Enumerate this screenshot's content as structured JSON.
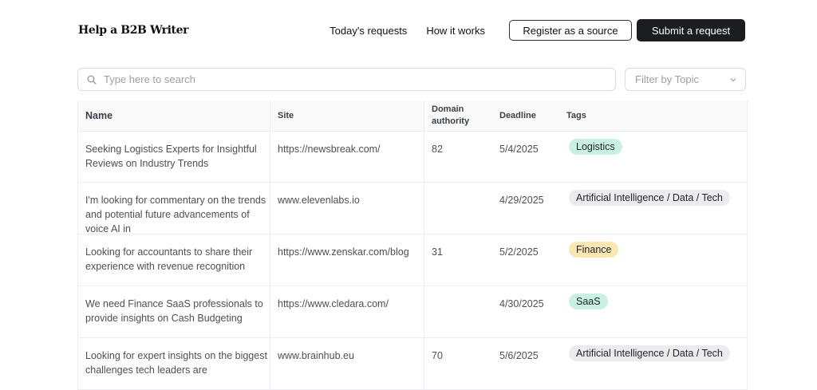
{
  "header": {
    "logo": "Help a B2B Writer",
    "nav": [
      "Today's requests",
      "How it works"
    ],
    "register_label": "Register as a source",
    "submit_label": "Submit a request"
  },
  "search": {
    "placeholder": "Type here to search",
    "icon": "search-icon"
  },
  "filter": {
    "placeholder": "Filter by Topic",
    "icon": "chevron-down-icon"
  },
  "table": {
    "headers": {
      "name": "Name",
      "site": "Site",
      "domain_authority": "Domain authority",
      "deadline": "Deadline",
      "tags": "Tags"
    },
    "rows": [
      {
        "name": "Seeking Logistics Experts for Insightful Reviews on Industry Trends",
        "site": "https://newsbreak.com/",
        "domain_authority": "82",
        "deadline": "5/4/2025",
        "tag": "Logistics",
        "tag_color": "#c9f0e2"
      },
      {
        "name": "I'm looking for commentary on the trends and potential future advancements of voice AI in",
        "site": "www.elevenlabs.io",
        "domain_authority": "",
        "deadline": "4/29/2025",
        "tag": "Artificial Intelligence / Data / Tech",
        "tag_color": "#ececee"
      },
      {
        "name": "Looking for accountants to share their experience with revenue recognition",
        "site": "https://www.zenskar.com/blog",
        "domain_authority": "31",
        "deadline": "5/2/2025",
        "tag": "Finance",
        "tag_color": "#fbe7b4"
      },
      {
        "name": "We need Finance SaaS professionals to provide insights on Cash Budgeting",
        "site": "https://www.cledara.com/",
        "domain_authority": "",
        "deadline": "4/30/2025",
        "tag": "SaaS",
        "tag_color": "#c9f0e2"
      },
      {
        "name": "Looking for expert insights on the biggest challenges tech leaders are",
        "site": "www.brainhub.eu",
        "domain_authority": "70",
        "deadline": "5/6/2025",
        "tag": "Artificial Intelligence / Data / Tech",
        "tag_color": "#ececee"
      }
    ]
  }
}
